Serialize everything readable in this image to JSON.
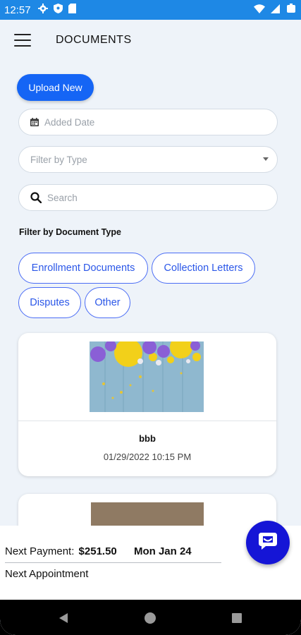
{
  "status_bar": {
    "time": "12:57"
  },
  "header": {
    "title": "DOCUMENTS"
  },
  "actions": {
    "upload_label": "Upload New"
  },
  "filters": {
    "date_placeholder": "Added Date",
    "type_placeholder": "Filter by Type",
    "search_placeholder": "Search",
    "section_label": "Filter by Document Type",
    "chips": [
      "Enrollment Documents",
      "Collection Letters",
      "Disputes",
      "Other"
    ]
  },
  "documents": [
    {
      "name": "bbb",
      "date": "01/29/2022 10:15 PM"
    }
  ],
  "bottom_sheet": {
    "payment_label": "Next Payment:",
    "payment_amount": "$251.50",
    "payment_date": "Mon Jan 24",
    "appointment_label": "Next Appointment"
  },
  "colors": {
    "primary": "#1565f5",
    "status_bar": "#1e88e5",
    "chat_fab": "#1515d6",
    "chip_text": "#2b57e8"
  },
  "icons": [
    "menu-icon",
    "calendar-icon",
    "search-icon",
    "chevron-down-icon",
    "chat-icon",
    "back-icon",
    "home-icon",
    "recents-icon"
  ]
}
